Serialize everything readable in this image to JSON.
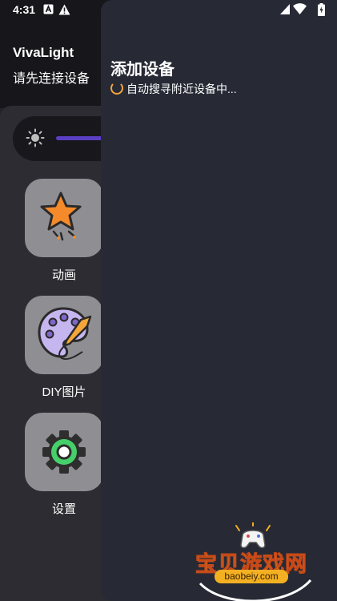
{
  "status_bar": {
    "time": "4:31",
    "left_icons": [
      "a-box-icon",
      "warning-icon"
    ],
    "right_icons": [
      "signal-icon",
      "wifi-icon",
      "battery-icon"
    ]
  },
  "header": {
    "title": "VivaLight",
    "subtitle": "请先连接设备"
  },
  "brightness": {
    "icon": "sun-icon",
    "level": 1.0
  },
  "menu": [
    {
      "label": "动画",
      "icon": "star-icon"
    },
    {
      "label": "DIY图片",
      "icon": "palette-icon"
    },
    {
      "label": "设置",
      "icon": "gear-icon"
    }
  ],
  "drawer": {
    "title": "添加设备",
    "status": "自动搜寻附近设备中..."
  },
  "watermark": {
    "text": "宝贝游戏网",
    "url": "baobeiy.com"
  },
  "colors": {
    "accent": "#5a3fc4",
    "spinner": "#f3a53a",
    "drawer_bg": "#272a35",
    "tile_bg": "#8e8e93"
  }
}
